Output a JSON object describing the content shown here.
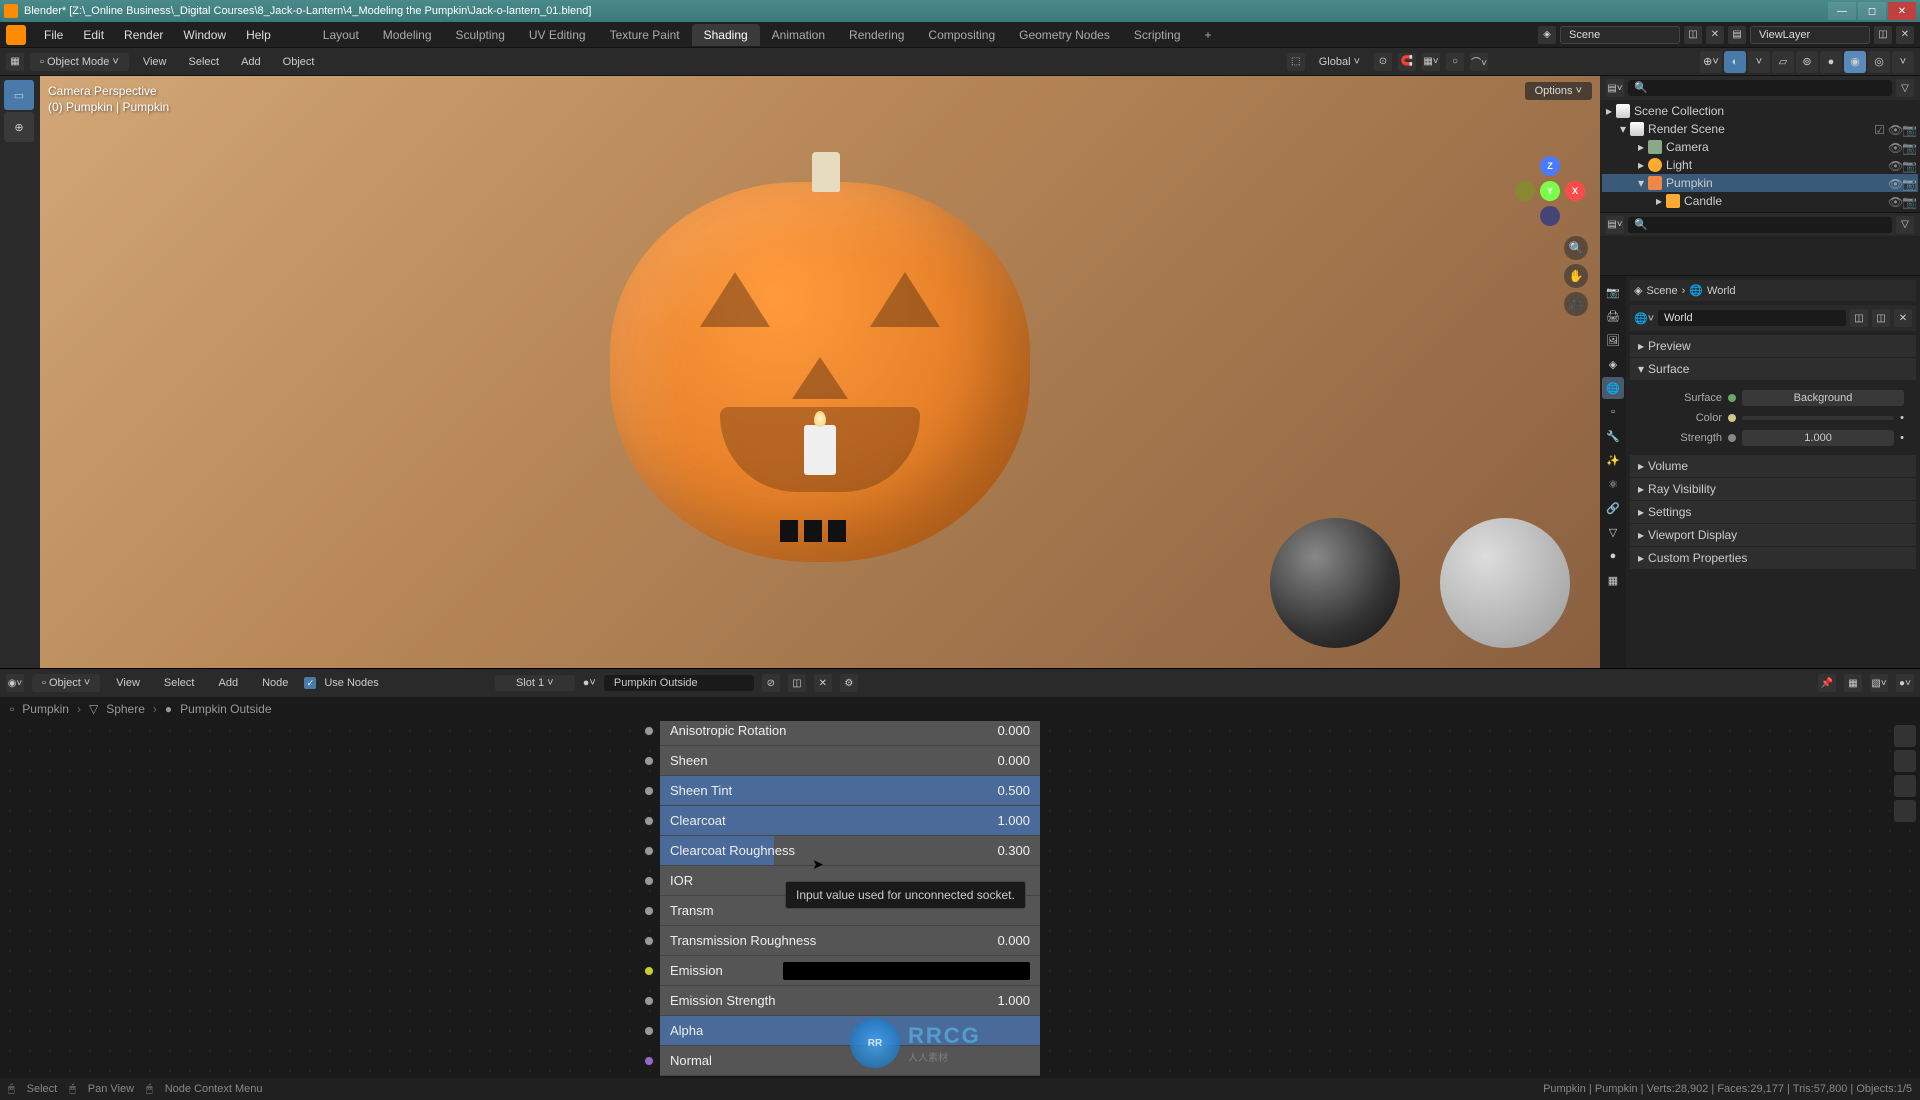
{
  "titlebar": {
    "title": "Blender* [Z:\\_Online Business\\_Digital Courses\\8_Jack-o-Lantern\\4_Modeling the Pumpkin\\Jack-o-lantern_01.blend]"
  },
  "menu": {
    "file": "File",
    "edit": "Edit",
    "render": "Render",
    "window": "Window",
    "help": "Help"
  },
  "workspaces": {
    "layout": "Layout",
    "modeling": "Modeling",
    "sculpting": "Sculpting",
    "uv": "UV Editing",
    "texture": "Texture Paint",
    "shading": "Shading",
    "animation": "Animation",
    "rendering": "Rendering",
    "compositing": "Compositing",
    "geometry": "Geometry Nodes",
    "scripting": "Scripting"
  },
  "scene": {
    "name": "Scene",
    "layer": "ViewLayer"
  },
  "toolbar": {
    "mode": "Object Mode",
    "view": "View",
    "select": "Select",
    "add": "Add",
    "object": "Object",
    "global": "Global",
    "options": "Options"
  },
  "viewport": {
    "label1": "Camera Perspective",
    "label2": "(0) Pumpkin | Pumpkin"
  },
  "gizmo": {
    "x": "X",
    "y": "Y",
    "z": "Z"
  },
  "outliner": {
    "collection": "Scene Collection",
    "render_scene": "Render Scene",
    "camera": "Camera",
    "light": "Light",
    "pumpkin": "Pumpkin",
    "candle": "Candle"
  },
  "properties": {
    "scene": "Scene",
    "world": "World",
    "world_name": "World",
    "preview": "Preview",
    "surface": "Surface",
    "surface_type": "Background",
    "color": "Color",
    "strength": "Strength",
    "strength_val": "1.000",
    "volume": "Volume",
    "ray": "Ray Visibility",
    "settings": "Settings",
    "viewport_display": "Viewport Display",
    "custom": "Custom Properties",
    "surface_label": "Surface"
  },
  "node_editor": {
    "object_menu": "Object",
    "view": "View",
    "select": "Select",
    "add": "Add",
    "node": "Node",
    "use_nodes": "Use Nodes",
    "slot": "Slot 1",
    "material": "Pumpkin Outside",
    "bc_pumpkin": "Pumpkin",
    "bc_sphere": "Sphere",
    "bc_material": "Pumpkin Outside"
  },
  "node": {
    "aniso_rot": {
      "label": "Anisotropic Rotation",
      "value": "0.000"
    },
    "sheen": {
      "label": "Sheen",
      "value": "0.000"
    },
    "sheen_tint": {
      "label": "Sheen Tint",
      "value": "0.500"
    },
    "clearcoat": {
      "label": "Clearcoat",
      "value": "1.000"
    },
    "clearcoat_rough": {
      "label": "Clearcoat Roughness",
      "value": "0.300"
    },
    "ior": {
      "label": "IOR"
    },
    "transm": {
      "label": "Transm"
    },
    "transm_rough": {
      "label": "Transmission Roughness",
      "value": "0.000"
    },
    "emission": {
      "label": "Emission"
    },
    "emission_strength": {
      "label": "Emission Strength",
      "value": "1.000"
    },
    "alpha": {
      "label": "Alpha"
    },
    "normal": {
      "label": "Normal"
    }
  },
  "tooltip": "Input value used for unconnected socket.",
  "watermark": {
    "text": "RRCG",
    "sub": "人人素材"
  },
  "statusbar": {
    "select": "Select",
    "pan": "Pan View",
    "context": "Node Context Menu",
    "info": "Pumpkin | Pumpkin | Verts:28,902 | Faces:29,177 | Tris:57,800 | Objects:1/5"
  }
}
